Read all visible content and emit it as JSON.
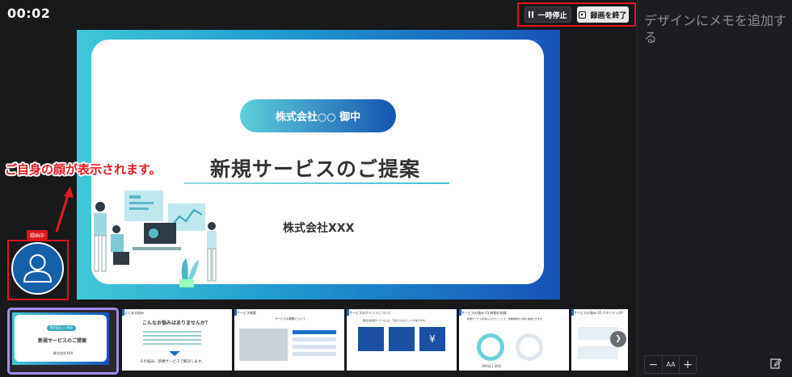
{
  "recording": {
    "timer": "00:02",
    "pause_label": "一時停止",
    "stop_label": "録画を終了",
    "badge_label": "録画中"
  },
  "notes": {
    "placeholder": "デザインにメモを追加する",
    "font_controls": [
      "−",
      "AA",
      "+"
    ]
  },
  "callout": {
    "text": "ご自身の顔が表示されます。"
  },
  "slide": {
    "company": "株式会社○○ 御中",
    "title": "新規サービスのご提案",
    "presenter": "株式会社XXX"
  },
  "thumbnails": [
    {
      "heading": "株式会社○○ 御中",
      "title": "新規サービスのご提案",
      "sub": "株式会社XXX",
      "selected": true
    },
    {
      "heading": "よくある悩み",
      "title": "こんなお悩みはありませんか？",
      "sub": "その悩み、新規サービスで解決します。"
    },
    {
      "heading": "サービス概要",
      "title": "サービスの概要について",
      "sub": ""
    },
    {
      "heading": "サービスのポイントについて",
      "title": "弊社の新規サービスには、下記3つのポイントがあります。",
      "sub": ""
    },
    {
      "heading": "サービスの強み 01.時間の削減",
      "title": "新規サービスを導入いただくことで、作業時間を大幅に削減できます。",
      "sub": "300分 / 30分"
    },
    {
      "heading": "サービスの強み 02.クオリティUP",
      "title": "",
      "sub": ""
    }
  ],
  "icons": {
    "pause": "pause-icon",
    "stop": "stop-icon",
    "edit": "edit-note-icon",
    "next": "chevron-right-icon"
  }
}
